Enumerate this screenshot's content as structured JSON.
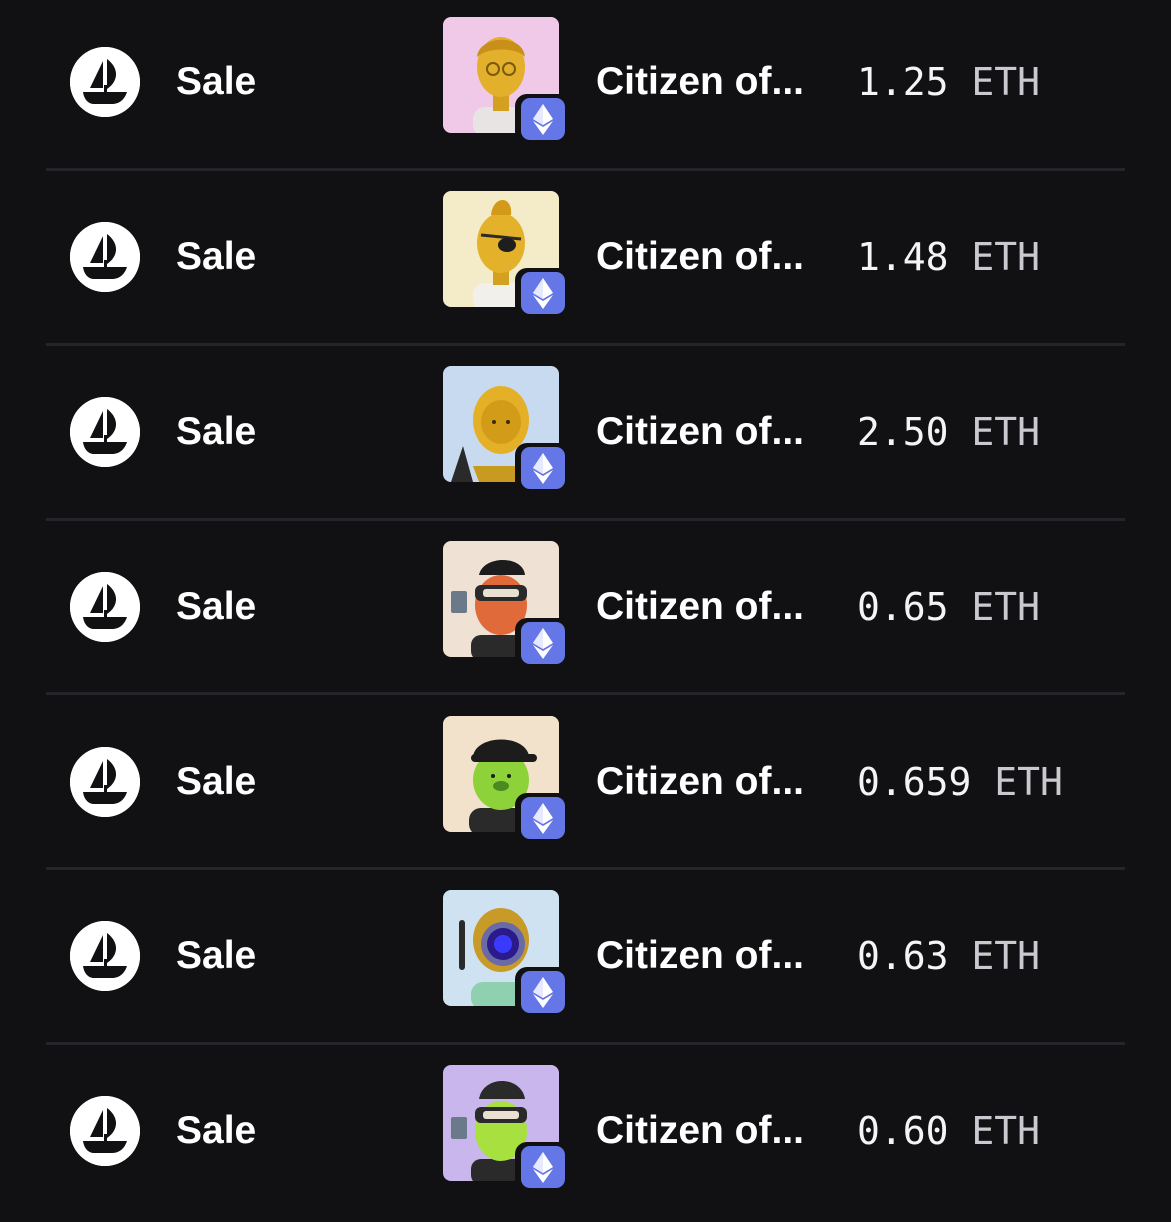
{
  "activity": {
    "rows": [
      {
        "event": "Sale",
        "item_name": "Citizen of...",
        "price": "1.25",
        "currency": "ETH",
        "chain_icon": "ethereum-icon",
        "event_icon": "opensea-boat-icon"
      },
      {
        "event": "Sale",
        "item_name": "Citizen of...",
        "price": "1.48",
        "currency": "ETH",
        "chain_icon": "ethereum-icon",
        "event_icon": "opensea-boat-icon"
      },
      {
        "event": "Sale",
        "item_name": "Citizen of...",
        "price": "2.50",
        "currency": "ETH",
        "chain_icon": "ethereum-icon",
        "event_icon": "opensea-boat-icon"
      },
      {
        "event": "Sale",
        "item_name": "Citizen of...",
        "price": "0.65",
        "currency": "ETH",
        "chain_icon": "ethereum-icon",
        "event_icon": "opensea-boat-icon"
      },
      {
        "event": "Sale",
        "item_name": "Citizen of...",
        "price": "0.659",
        "currency": "ETH",
        "chain_icon": "ethereum-icon",
        "event_icon": "opensea-boat-icon"
      },
      {
        "event": "Sale",
        "item_name": "Citizen of...",
        "price": "0.63",
        "currency": "ETH",
        "chain_icon": "ethereum-icon",
        "event_icon": "opensea-boat-icon"
      },
      {
        "event": "Sale",
        "item_name": "Citizen of...",
        "price": "0.60",
        "currency": "ETH",
        "chain_icon": "ethereum-icon",
        "event_icon": "opensea-boat-icon"
      }
    ]
  },
  "colors": {
    "background": "#111113",
    "divider": "#24242a",
    "badge": "#6577e6"
  }
}
